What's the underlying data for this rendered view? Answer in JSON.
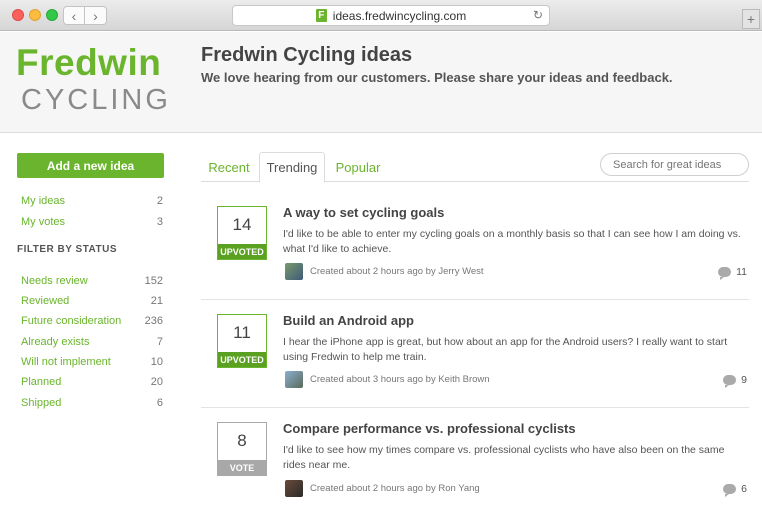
{
  "browser": {
    "url": "ideas.fredwincycling.com",
    "favicon_letter": "F"
  },
  "header": {
    "logo_top": "Fredwin",
    "logo_bottom": "CYCLING",
    "title": "Fredwin Cycling ideas",
    "subtitle": "We love hearing from our customers. Please share your ideas and feedback."
  },
  "sidebar": {
    "add_button": "Add a new idea",
    "my": [
      {
        "label": "My ideas",
        "count": "2"
      },
      {
        "label": "My votes",
        "count": "3"
      }
    ],
    "filter_heading": "FILTER BY STATUS",
    "statuses": [
      {
        "label": "Needs review",
        "count": "152"
      },
      {
        "label": "Reviewed",
        "count": "21"
      },
      {
        "label": "Future consideration",
        "count": "236"
      },
      {
        "label": "Already exists",
        "count": "7"
      },
      {
        "label": "Will not implement",
        "count": "10"
      },
      {
        "label": "Planned",
        "count": "20"
      },
      {
        "label": "Shipped",
        "count": "6"
      }
    ]
  },
  "tabs": {
    "recent": "Recent",
    "trending": "Trending",
    "popular": "Popular",
    "active": "Trending"
  },
  "search": {
    "placeholder": "Search for great ideas"
  },
  "ideas": [
    {
      "votes": "14",
      "vote_label": "UPVOTED",
      "title": "A way to set cycling goals",
      "body": "I'd like to be able to enter my cycling goals on a monthly basis so that I can see how I am doing vs. what I'd like to achieve.",
      "meta": "Created about 2 hours ago by Jerry West",
      "comments": "11"
    },
    {
      "votes": "11",
      "vote_label": "UPVOTED",
      "title": "Build an Android app",
      "body": "I hear the iPhone app is great, but how about an app for the Android users? I really want to start using Fredwin to help me train.",
      "meta": "Created about 3 hours ago by Keith Brown",
      "comments": "9"
    },
    {
      "votes": "8",
      "vote_label": "VOTE",
      "title": "Compare performance vs. professional cyclists",
      "body": "I'd like to see how my times compare vs. professional cyclists who have also been on the same rides near me.",
      "meta": "Created about 2 hours ago by Ron Yang",
      "comments": "6"
    }
  ],
  "colors": {
    "brand_green": "#6ab52d",
    "upvoted_green": "#5aa021",
    "vote_gray": "#a8a8a8"
  }
}
